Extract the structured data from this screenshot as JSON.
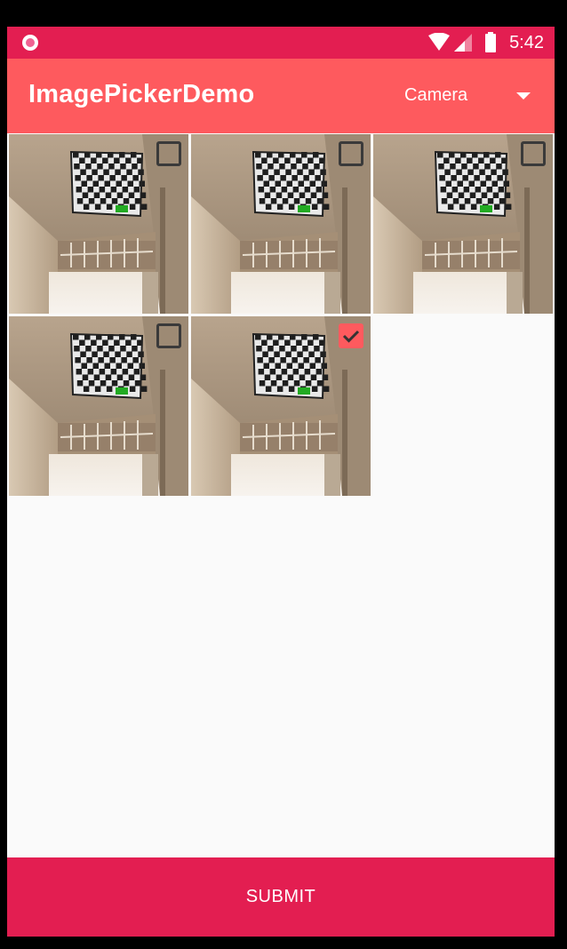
{
  "status_bar": {
    "time": "5:42",
    "notification_icon": "record-dot-icon",
    "icons": [
      "wifi-icon",
      "signal-icon",
      "battery-icon"
    ]
  },
  "app_bar": {
    "title": "ImagePickerDemo",
    "source_selector": {
      "selected": "Camera",
      "icon": "dropdown-arrow-icon"
    }
  },
  "images": [
    {
      "checked": false
    },
    {
      "checked": false
    },
    {
      "checked": false
    },
    {
      "checked": false
    },
    {
      "checked": true
    }
  ],
  "submit": {
    "label": "SUBMIT"
  },
  "colors": {
    "status_bar": "#e31e51",
    "app_bar": "#fe5a5e",
    "accent": "#fe5a5e",
    "submit_bar": "#e31e51",
    "background": "#fafafa"
  }
}
